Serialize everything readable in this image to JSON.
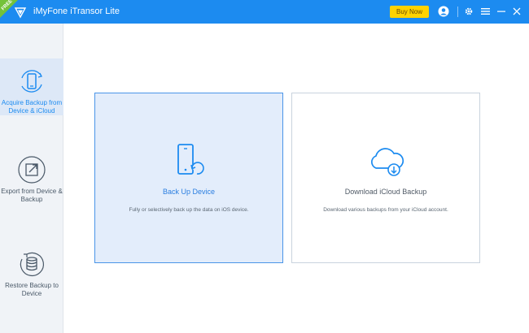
{
  "window": {
    "title": "iMyFone iTransor Lite",
    "badge": "FREE",
    "buy_label": "Buy Now"
  },
  "sidebar": {
    "items": [
      {
        "label": "Acquire Backup from Device & iCloud",
        "icon": "phone-sync-icon",
        "active": true
      },
      {
        "label": "Export from Device & Backup",
        "icon": "export-icon",
        "active": false
      },
      {
        "label": "Restore Backup to Device",
        "icon": "database-restore-icon",
        "active": false
      }
    ]
  },
  "main": {
    "cards": [
      {
        "title": "Back Up Device",
        "description": "Fully or selectively back up the data on iOS device.",
        "icon": "phone-backup-icon",
        "selected": true
      },
      {
        "title": "Download iCloud Backup",
        "description": "Download various backups from your iCloud account.",
        "icon": "cloud-download-icon",
        "selected": false
      }
    ]
  },
  "colors": {
    "accent": "#1c8bf0",
    "buy": "#ffd200"
  }
}
